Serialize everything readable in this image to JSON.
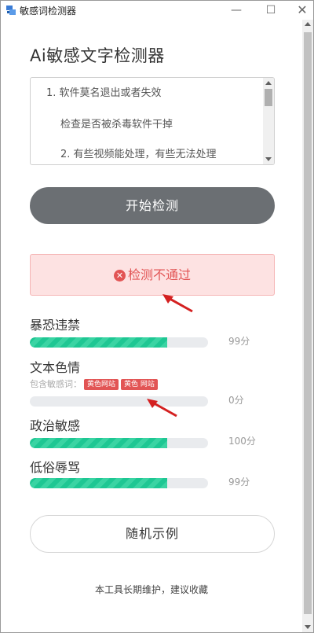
{
  "window": {
    "title": "敏感词检测器",
    "minimize": "—",
    "maximize": "☐",
    "close": "✕"
  },
  "app_title": "Ai敏感文字检测器",
  "input": {
    "lines": [
      "1. 软件莫名退出或者失效",
      "检查是否被杀毒软件干掉",
      "2. 有些视频能处理，有些无法处理"
    ]
  },
  "start_button": "开始检测",
  "result": {
    "icon": "x-circle-icon",
    "text": "检测不通过",
    "color": "#e25555"
  },
  "categories": [
    {
      "name": "暴恐违禁",
      "score": "99分",
      "value": 0.77
    },
    {
      "name": "文本色情",
      "score": "0分",
      "value": 0,
      "sensitive_label": "包含敏感词：",
      "tags": [
        "黄色网站",
        "黄色 网站"
      ]
    },
    {
      "name": "政治敏感",
      "score": "100分",
      "value": 0.77
    },
    {
      "name": "低俗辱骂",
      "score": "99分",
      "value": 0.77
    }
  ],
  "random_button": "随机示例",
  "footer": "本工具长期维护，建议收藏",
  "colors": {
    "bar_fill": "#1ec793",
    "button_dark": "#6b6f73",
    "alert_bg": "#fde2e2"
  }
}
